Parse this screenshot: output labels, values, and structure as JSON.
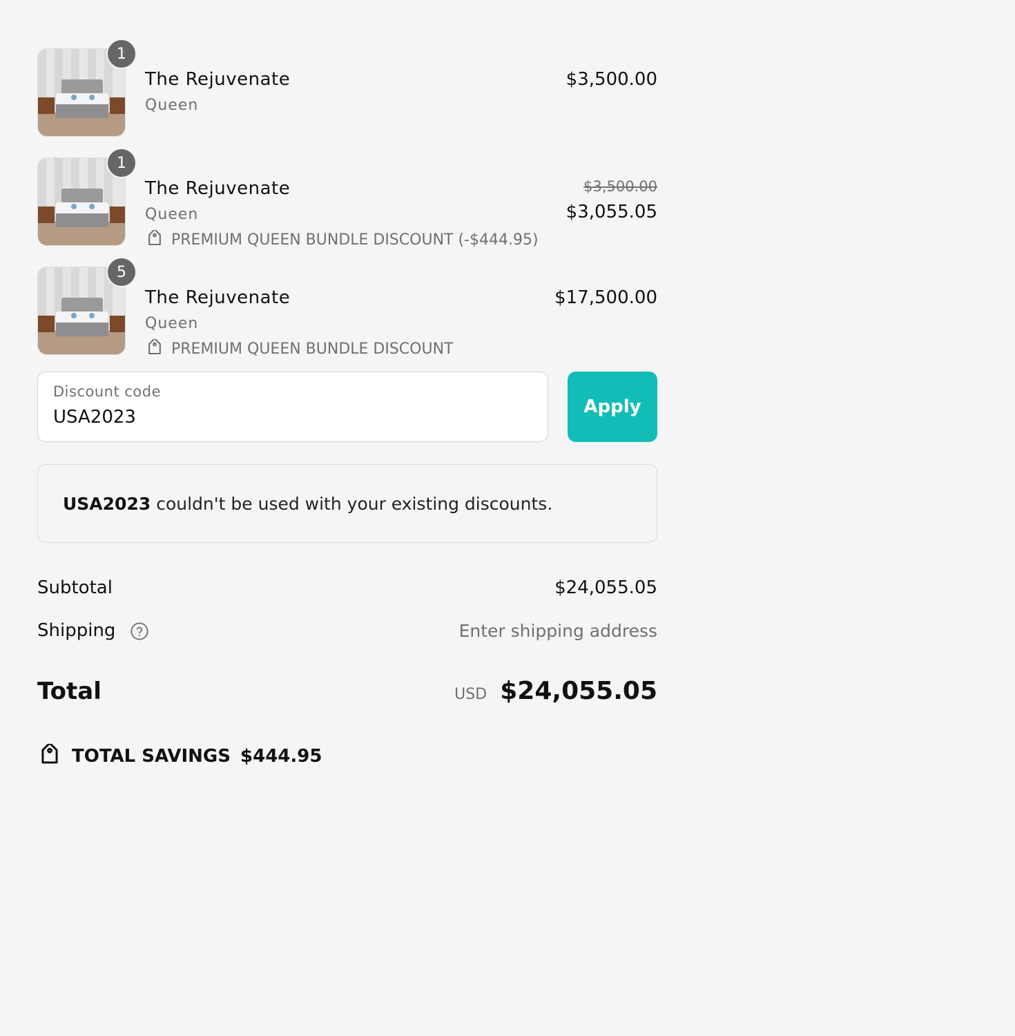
{
  "line_items": [
    {
      "quantity": "1",
      "title": "The Rejuvenate",
      "variant": "Queen",
      "discount": "",
      "original_price": "",
      "price": "$3,500.00"
    },
    {
      "quantity": "1",
      "title": "The Rejuvenate",
      "variant": "Queen",
      "discount": "PREMIUM QUEEN BUNDLE DISCOUNT (-$444.95)",
      "original_price": "$3,500.00",
      "price": "$3,055.05"
    },
    {
      "quantity": "5",
      "title": "The Rejuvenate",
      "variant": "Queen",
      "discount": "PREMIUM QUEEN BUNDLE DISCOUNT",
      "original_price": "",
      "price": "$17,500.00"
    }
  ],
  "discount": {
    "label": "Discount code",
    "value": "USA2023",
    "apply_label": "Apply"
  },
  "error": {
    "code": "USA2023",
    "message": "couldn't be used with your existing discounts."
  },
  "totals": {
    "subtotal_label": "Subtotal",
    "subtotal_value": "$24,055.05",
    "shipping_label": "Shipping",
    "shipping_value": "Enter shipping address",
    "total_label": "Total",
    "currency": "USD",
    "total_value": "$24,055.05",
    "savings_label": "TOTAL SAVINGS",
    "savings_value": "$444.95"
  },
  "colors": {
    "accent": "#13bdb7",
    "background": "#f5f5f5",
    "muted_text": "#707070",
    "badge": "#666666"
  },
  "icons": {
    "tag": "tag-icon",
    "help": "help-circle-icon"
  }
}
